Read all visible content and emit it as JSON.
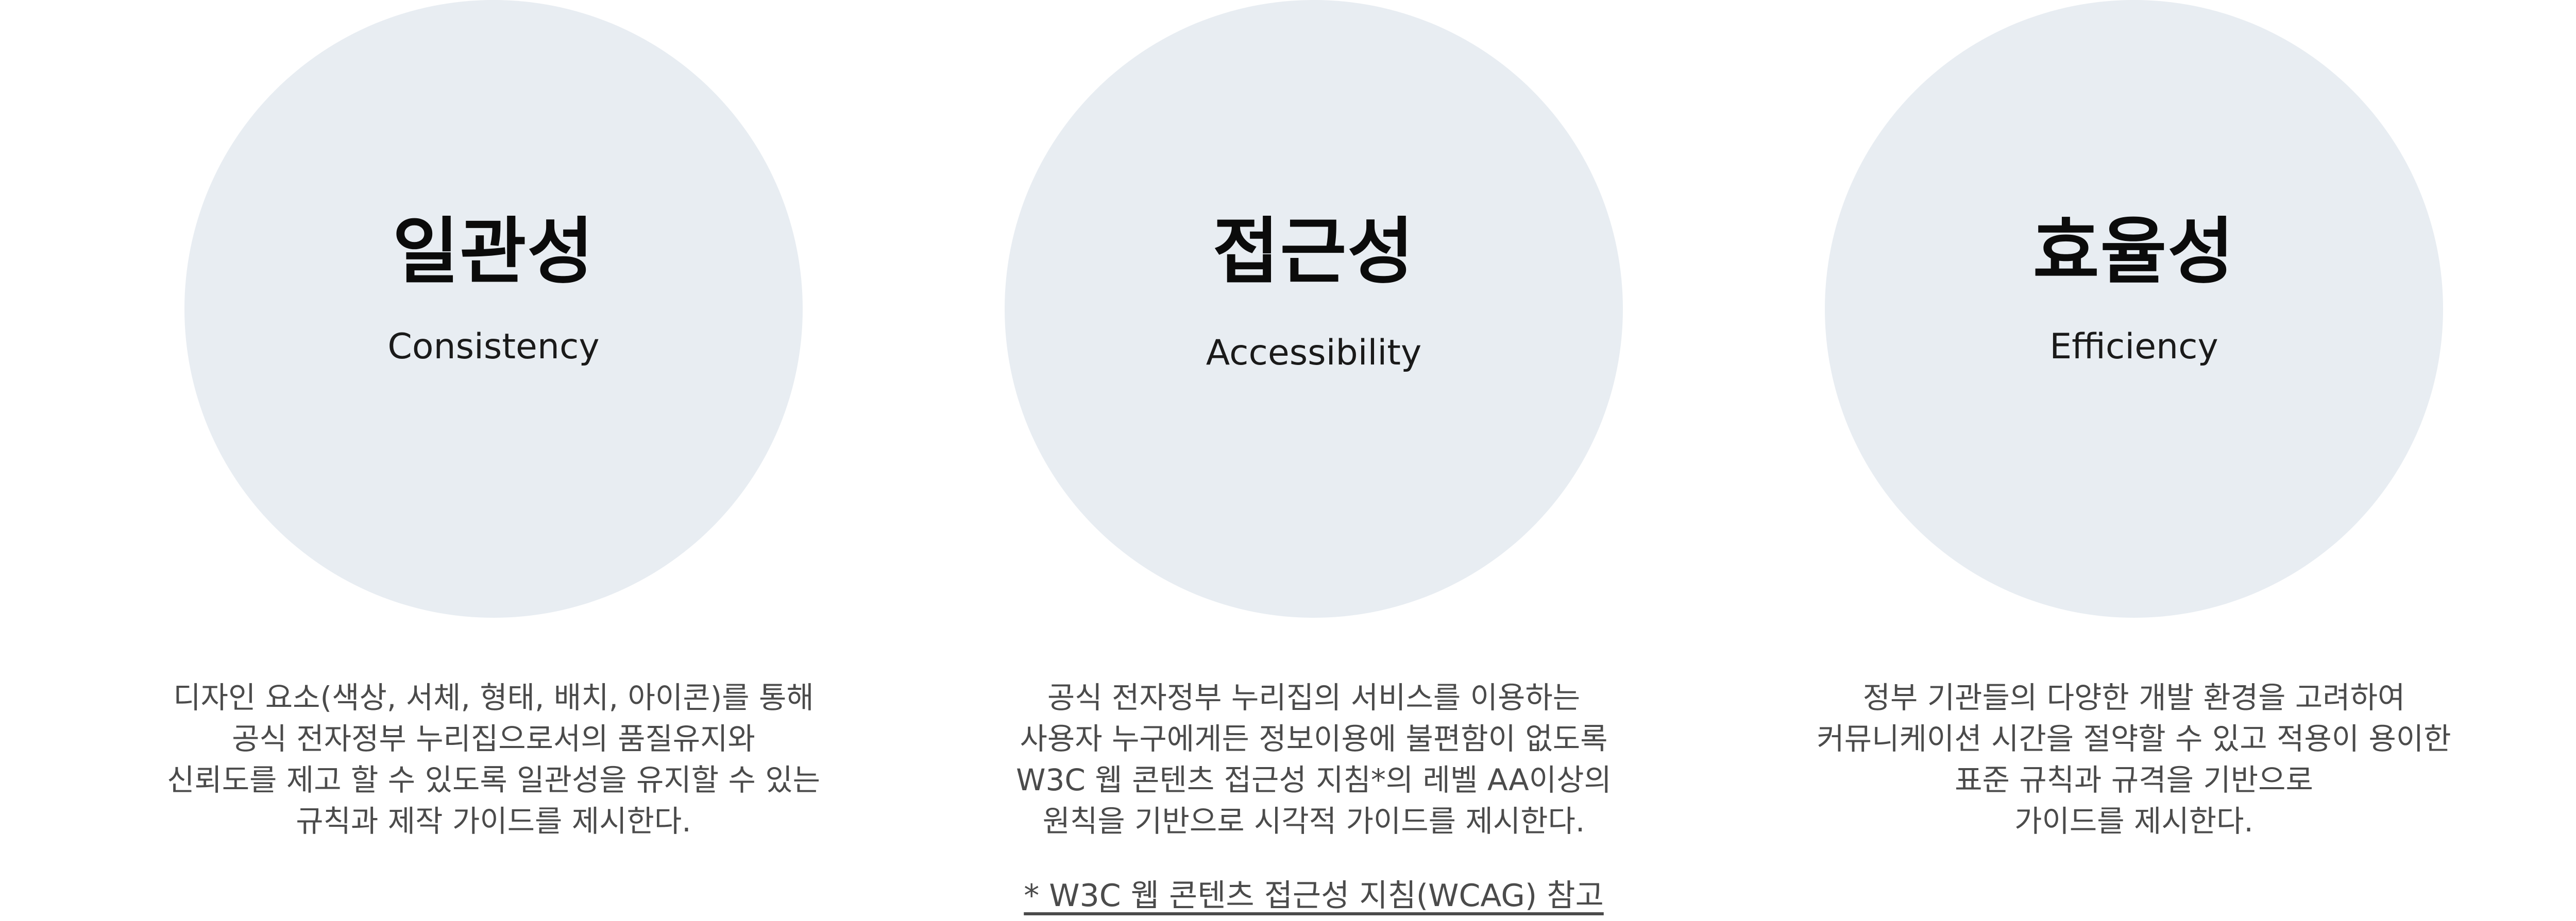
{
  "principles": [
    {
      "title_ko": "일관성",
      "title_en": "Consistency",
      "description": [
        "디자인 요소(색상, 서체, 형태, 배치, 아이콘)를 통해",
        "공식 전자정부 누리집으로서의 품질유지와",
        "신뢰도를 제고 할 수 있도록 일관성을 유지할 수 있는",
        "규칙과 제작 가이드를 제시한다."
      ]
    },
    {
      "title_ko": "접근성",
      "title_en": "Accessibility",
      "description": [
        "공식 전자정부 누리집의 서비스를 이용하는",
        "사용자 누구에게든 정보이용에 불편함이 없도록",
        "W3C 웹 콘텐츠 접근성 지침*의 레벨 AA이상의",
        "원칙을 기반으로 시각적 가이드를 제시한다."
      ],
      "note": "* W3C 웹 콘텐츠 접근성 지침(WCAG) 참고"
    },
    {
      "title_ko": "효율성",
      "title_en": "Efficiency",
      "description": [
        "정부 기관들의 다양한 개발 환경을 고려하여",
        "커뮤니케이션 시간을 절약할 수 있고 적용이 용이한",
        "표준 규칙과 규격을 기반으로",
        "가이드를 제시한다."
      ]
    }
  ],
  "colors": {
    "circle_fill": "#e8edf2",
    "title": "#0b0b0b",
    "body_text": "#4b4b4b"
  }
}
